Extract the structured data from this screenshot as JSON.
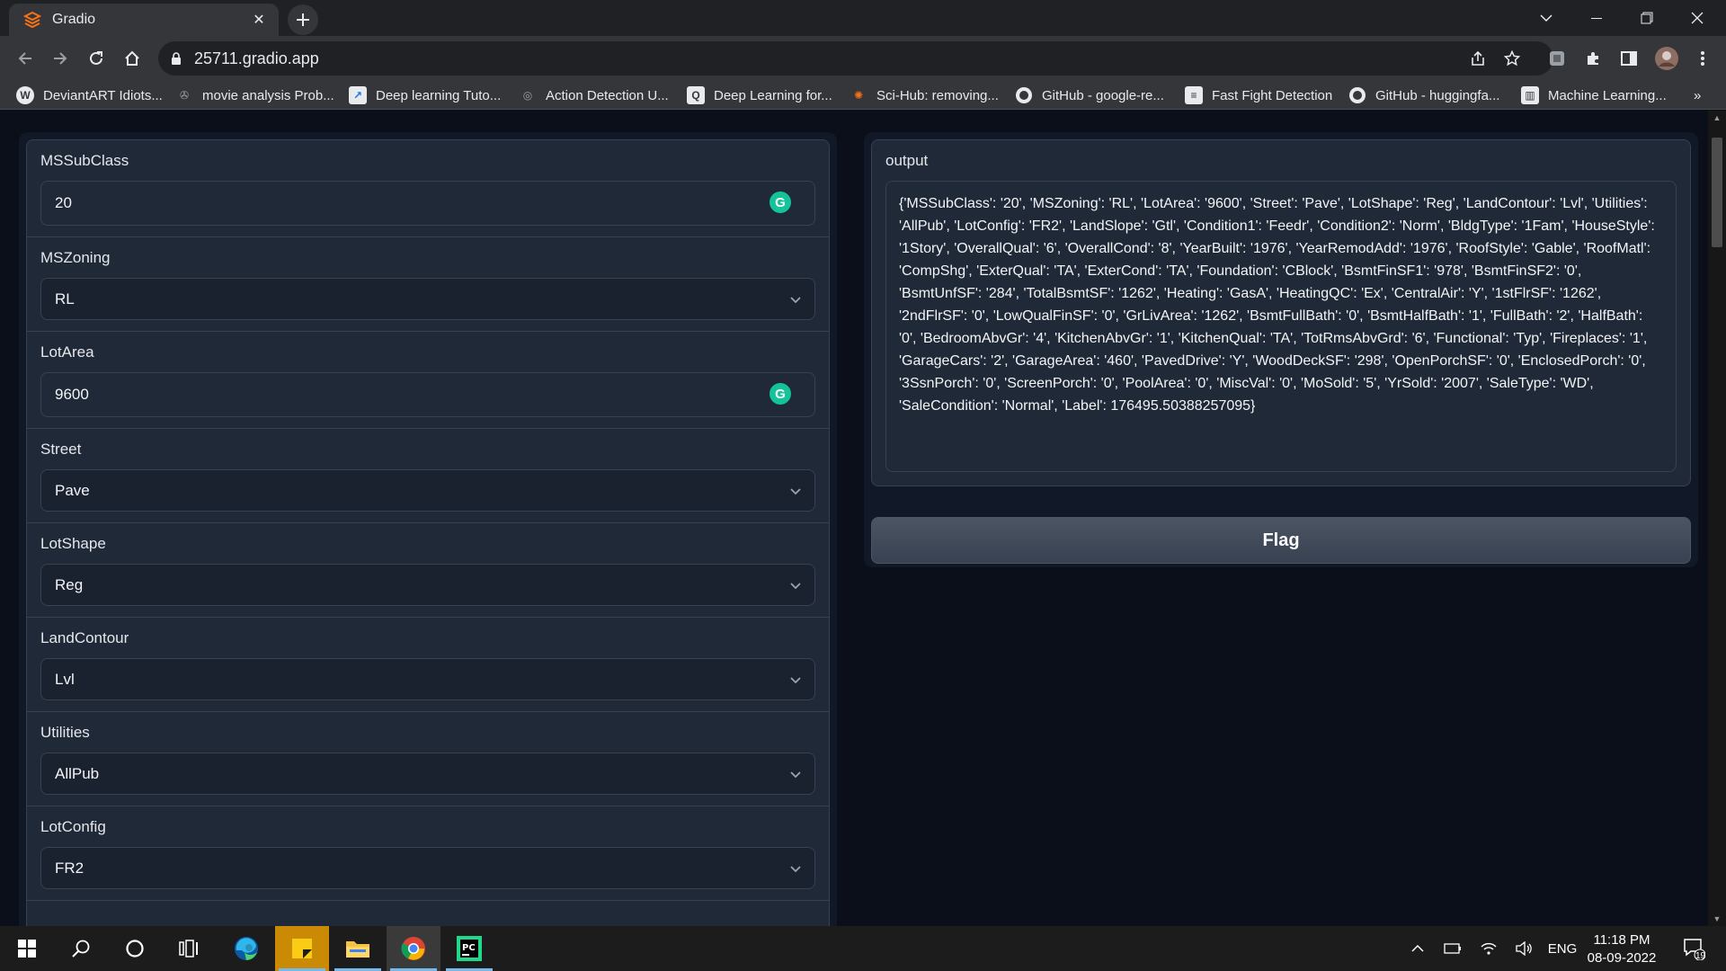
{
  "browser": {
    "tab_title": "Gradio",
    "url": "25711.gradio.app",
    "bookmarks": [
      {
        "label": "DeviantART Idiots...",
        "icon": "wordpress-icon"
      },
      {
        "label": "movie analysis Prob...",
        "icon": "film-icon"
      },
      {
        "label": "Deep learning Tuto...",
        "icon": "chart-icon"
      },
      {
        "label": "Action Detection U...",
        "icon": "globe-icon"
      },
      {
        "label": "Deep Learning for...",
        "icon": "document-icon"
      },
      {
        "label": "Sci-Hub: removing...",
        "icon": "scihub-icon"
      },
      {
        "label": "GitHub - google-re...",
        "icon": "github-icon"
      },
      {
        "label": "Fast Fight Detection",
        "icon": "paper-icon"
      },
      {
        "label": "GitHub - huggingfa...",
        "icon": "github-icon"
      },
      {
        "label": "Machine Learning...",
        "icon": "book-icon"
      }
    ]
  },
  "form": {
    "fields": [
      {
        "label": "MSSubClass",
        "type": "textbox",
        "value": "20"
      },
      {
        "label": "MSZoning",
        "type": "dropdown",
        "value": "RL"
      },
      {
        "label": "LotArea",
        "type": "textbox",
        "value": "9600"
      },
      {
        "label": "Street",
        "type": "dropdown",
        "value": "Pave"
      },
      {
        "label": "LotShape",
        "type": "dropdown",
        "value": "Reg"
      },
      {
        "label": "LandContour",
        "type": "dropdown",
        "value": "Lvl"
      },
      {
        "label": "Utilities",
        "type": "dropdown",
        "value": "AllPub"
      },
      {
        "label": "LotConfig",
        "type": "dropdown",
        "value": "FR2"
      }
    ]
  },
  "output": {
    "label": "output",
    "text": "{'MSSubClass': '20', 'MSZoning': 'RL', 'LotArea': '9600', 'Street': 'Pave', 'LotShape': 'Reg', 'LandContour': 'Lvl', 'Utilities': 'AllPub', 'LotConfig': 'FR2', 'LandSlope': 'Gtl', 'Condition1': 'Feedr', 'Condition2': 'Norm', 'BldgType': '1Fam', 'HouseStyle': '1Story', 'OverallQual': '6', 'OverallCond': '8', 'YearBuilt': '1976', 'YearRemodAdd': '1976', 'RoofStyle': 'Gable', 'RoofMatl': 'CompShg', 'ExterQual': 'TA', 'ExterCond': 'TA', 'Foundation': 'CBlock', 'BsmtFinSF1': '978', 'BsmtFinSF2': '0', 'BsmtUnfSF': '284', 'TotalBsmtSF': '1262', 'Heating': 'GasA', 'HeatingQC': 'Ex', 'CentralAir': 'Y', '1stFlrSF': '1262', '2ndFlrSF': '0', 'LowQualFinSF': '0', 'GrLivArea': '1262', 'BsmtFullBath': '0', 'BsmtHalfBath': '1', 'FullBath': '2', 'HalfBath': '0', 'BedroomAbvGr': '4', 'KitchenAbvGr': '1', 'KitchenQual': 'TA', 'TotRmsAbvGrd': '6', 'Functional': 'Typ', 'Fireplaces': '1', 'GarageCars': '2', 'GarageArea': '460', 'PavedDrive': 'Y', 'WoodDeckSF': '298', 'OpenPorchSF': '0', 'EnclosedPorch': '0', '3SsnPorch': '0', 'ScreenPorch': '0', 'PoolArea': '0', 'MiscVal': '0', 'MoSold': '5', 'YrSold': '2007', 'SaleType': 'WD', 'SaleCondition': 'Normal', 'Label': 176495.50388257095}",
    "flag_label": "Flag"
  },
  "taskbar": {
    "language": "ENG",
    "time": "11:18 PM",
    "date": "08-09-2022",
    "notification_count": "19"
  },
  "colors": {
    "page_bg": "#0b0f19",
    "panel_bg": "#1f2937",
    "border": "#374151",
    "grammarly": "#15c39a"
  }
}
